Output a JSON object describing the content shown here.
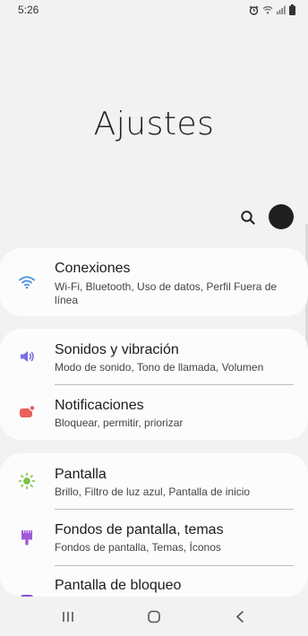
{
  "status": {
    "time": "5:26"
  },
  "header": {
    "title": "Ajustes"
  },
  "sections": [
    {
      "items": [
        {
          "label": "Conexiones",
          "sub": "Wi-Fi, Bluetooth, Uso de datos, Perfil Fuera de línea",
          "icon": "wifi-icon",
          "color": "#4a90e2"
        }
      ]
    },
    {
      "items": [
        {
          "label": "Sonidos y vibración",
          "sub": "Modo de sonido, Tono de llamada, Volumen",
          "icon": "speaker-icon",
          "color": "#7b6ee0"
        },
        {
          "label": "Notificaciones",
          "sub": "Bloquear, permitir, priorizar",
          "icon": "notification-icon",
          "color": "#e9615a"
        }
      ]
    },
    {
      "items": [
        {
          "label": "Pantalla",
          "sub": "Brillo, Filtro de luz azul, Pantalla de inicio",
          "icon": "sun-icon",
          "color": "#7cc242"
        },
        {
          "label": "Fondos de pantalla, temas",
          "sub": "Fondos de pantalla, Temas, Íconos",
          "icon": "brush-icon",
          "color": "#a05ad8"
        },
        {
          "label": "Pantalla de bloqueo",
          "sub": "",
          "icon": "lock-screen-icon",
          "color": "#8a4fd0"
        }
      ]
    }
  ]
}
